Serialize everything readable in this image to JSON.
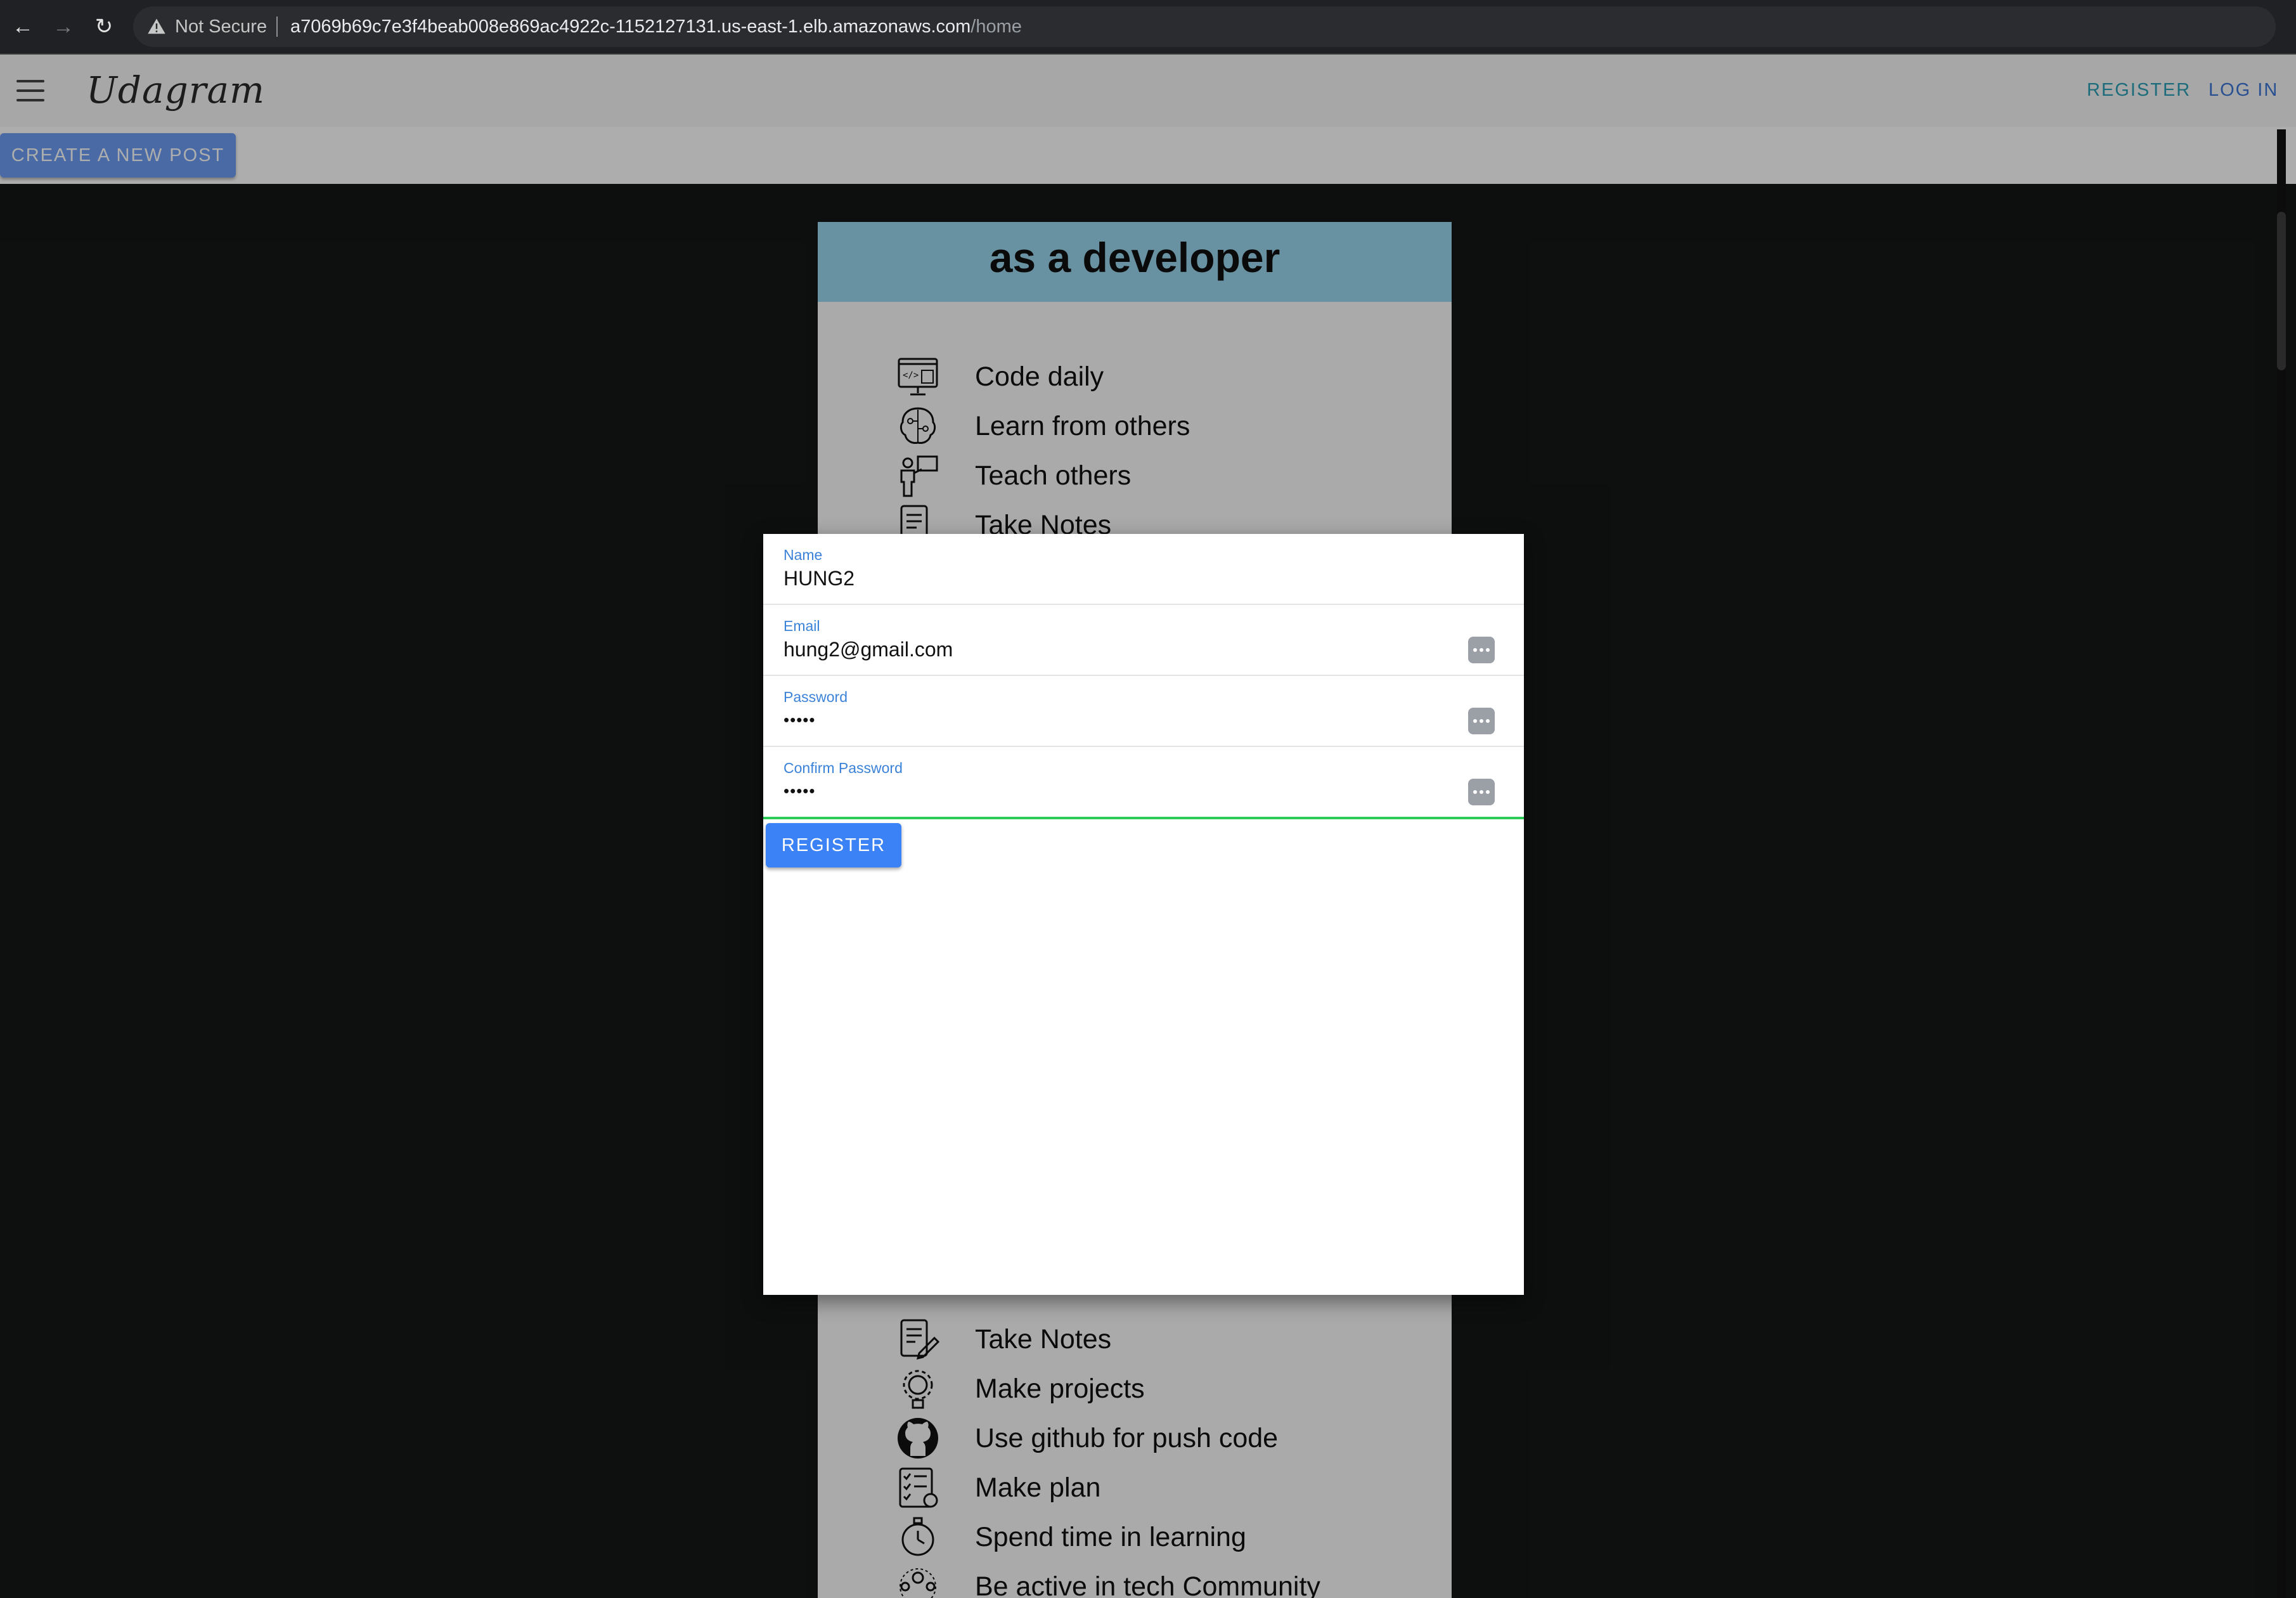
{
  "browser": {
    "security_label": "Not Secure",
    "url_host": "a7069b69c7e3f4beab008e869ac4922c-1152127131.us-east-1.elb.amazonaws.com",
    "url_path": "/home"
  },
  "app": {
    "brand": "Udagram",
    "nav": {
      "register": "REGISTER",
      "login": "LOG IN"
    },
    "create_post": "CREATE A NEW POST"
  },
  "post": {
    "title": "as a developer",
    "items_top": [
      {
        "label": "Code daily",
        "icon": "code-screen-icon"
      },
      {
        "label": "Learn from others",
        "icon": "brain-icon"
      },
      {
        "label": "Teach others",
        "icon": "teacher-icon"
      },
      {
        "label": "Take Notes",
        "icon": "notes-icon"
      }
    ],
    "items_bottom": [
      {
        "label": "Take Notes",
        "icon": "notes-icon"
      },
      {
        "label": "Make projects",
        "icon": "gear-brain-icon"
      },
      {
        "label": "Use github for push code",
        "icon": "github-icon"
      },
      {
        "label": "Make plan",
        "icon": "checklist-icon"
      },
      {
        "label": "Spend time in learning",
        "icon": "stopwatch-icon"
      },
      {
        "label": "Be active in tech Community",
        "icon": "community-icon"
      }
    ]
  },
  "form": {
    "name": {
      "label": "Name",
      "value": "HUNG2"
    },
    "email": {
      "label": "Email",
      "value": "hung2@gmail.com"
    },
    "password": {
      "label": "Password",
      "value": "•••••"
    },
    "confirm_password": {
      "label": "Confirm Password",
      "value": "•••••"
    },
    "submit_label": "REGISTER"
  },
  "colors": {
    "accent": "#3b82f6",
    "field_label": "#3b82d9",
    "valid_underline": "#2dcc59",
    "register_link": "#2c9fb6",
    "login_link": "#3b76d6"
  }
}
